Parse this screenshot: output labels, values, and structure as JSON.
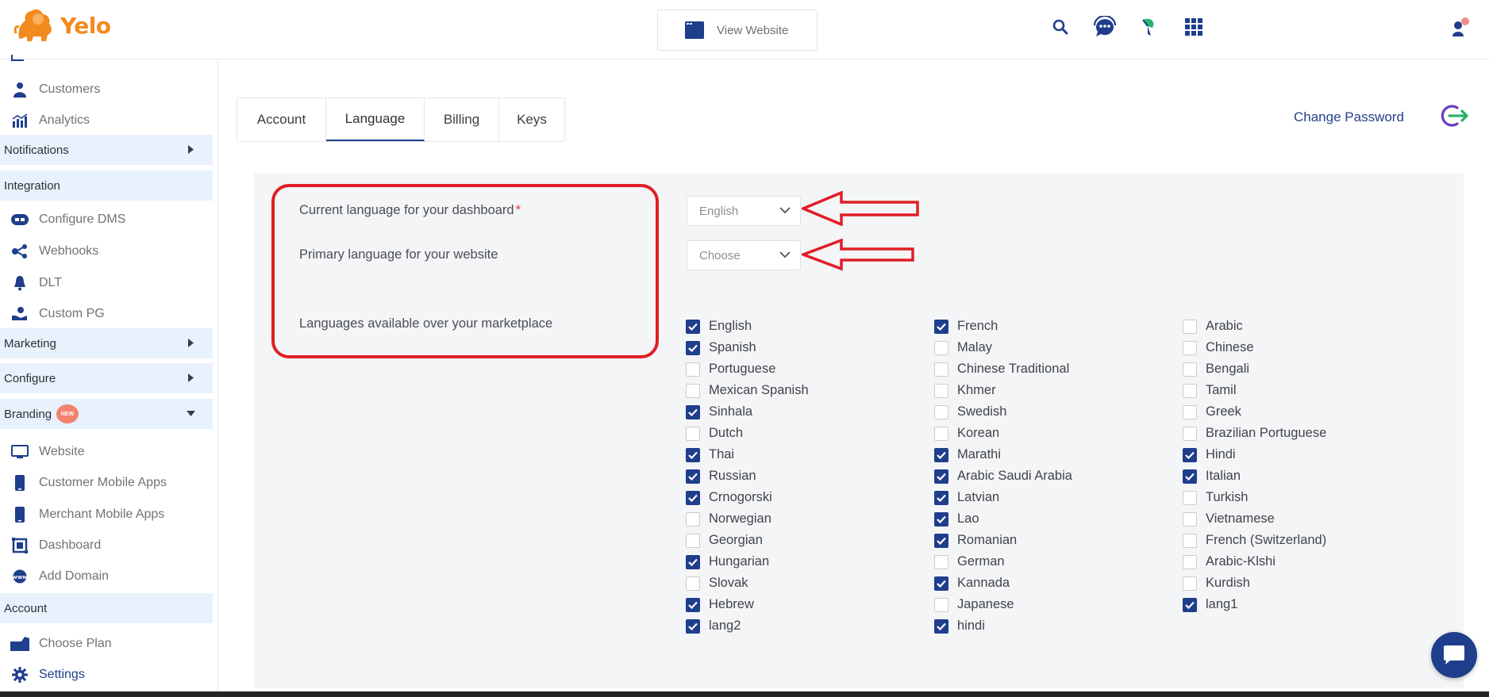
{
  "header": {
    "brand": "Yelo",
    "view_website": "View Website"
  },
  "colors": {
    "brand": "#f28a1e",
    "primary": "#1f3e8c",
    "highlight": "#e01e25",
    "section_bg": "#e8f2fd"
  },
  "sidebar": {
    "customers": "Customers",
    "analytics": "Analytics",
    "notifications": "Notifications",
    "integration": "Integration",
    "configure_dms": "Configure DMS",
    "webhooks": "Webhooks",
    "dlt": "DLT",
    "custom_pg": "Custom PG",
    "marketing": "Marketing",
    "configure": "Configure",
    "branding": "Branding",
    "new_badge": "NEW",
    "website": "Website",
    "customer_mobile_apps": "Customer Mobile Apps",
    "merchant_mobile_apps": "Merchant Mobile Apps",
    "dashboard": "Dashboard",
    "add_domain": "Add Domain",
    "account": "Account",
    "choose_plan": "Choose Plan",
    "settings": "Settings"
  },
  "tabs": [
    "Account",
    "Language",
    "Billing",
    "Keys"
  ],
  "active_tab": "Language",
  "change_password": "Change Password",
  "form": {
    "current_label": "Current language for your dashboard",
    "required_mark": "*",
    "current_value": "English",
    "primary_label": "Primary language for your website",
    "primary_placeholder": "Choose",
    "available_label": "Languages available over your marketplace"
  },
  "languages": [
    [
      {
        "name": "English",
        "checked": true
      },
      {
        "name": "Spanish",
        "checked": true
      },
      {
        "name": "Portuguese",
        "checked": false
      },
      {
        "name": "Mexican Spanish",
        "checked": false
      },
      {
        "name": "Sinhala",
        "checked": true
      },
      {
        "name": "Dutch",
        "checked": false
      },
      {
        "name": "Thai",
        "checked": true
      },
      {
        "name": "Russian",
        "checked": true
      },
      {
        "name": "Crnogorski",
        "checked": true
      },
      {
        "name": "Norwegian",
        "checked": false
      },
      {
        "name": "Georgian",
        "checked": false
      },
      {
        "name": "Hungarian",
        "checked": true
      },
      {
        "name": "Slovak",
        "checked": false
      },
      {
        "name": "Hebrew",
        "checked": true
      },
      {
        "name": "lang2",
        "checked": true
      }
    ],
    [
      {
        "name": "French",
        "checked": true
      },
      {
        "name": "Malay",
        "checked": false
      },
      {
        "name": "Chinese Traditional",
        "checked": false
      },
      {
        "name": "Khmer",
        "checked": false
      },
      {
        "name": "Swedish",
        "checked": false
      },
      {
        "name": "Korean",
        "checked": false
      },
      {
        "name": "Marathi",
        "checked": true
      },
      {
        "name": "Arabic Saudi Arabia",
        "checked": true
      },
      {
        "name": "Latvian",
        "checked": true
      },
      {
        "name": "Lao",
        "checked": true
      },
      {
        "name": "Romanian",
        "checked": true
      },
      {
        "name": "German",
        "checked": false
      },
      {
        "name": "Kannada",
        "checked": true
      },
      {
        "name": "Japanese",
        "checked": false
      },
      {
        "name": "hindi",
        "checked": true
      }
    ],
    [
      {
        "name": "Arabic",
        "checked": false
      },
      {
        "name": "Chinese",
        "checked": false
      },
      {
        "name": "Bengali",
        "checked": false
      },
      {
        "name": "Tamil",
        "checked": false
      },
      {
        "name": "Greek",
        "checked": false
      },
      {
        "name": "Brazilian Portuguese",
        "checked": false
      },
      {
        "name": "Hindi",
        "checked": true
      },
      {
        "name": "Italian",
        "checked": true
      },
      {
        "name": "Turkish",
        "checked": false
      },
      {
        "name": "Vietnamese",
        "checked": false
      },
      {
        "name": "French (Switzerland)",
        "checked": false
      },
      {
        "name": "Arabic-Klshi",
        "checked": false
      },
      {
        "name": "Kurdish",
        "checked": false
      },
      {
        "name": "lang1",
        "checked": true
      }
    ]
  ]
}
